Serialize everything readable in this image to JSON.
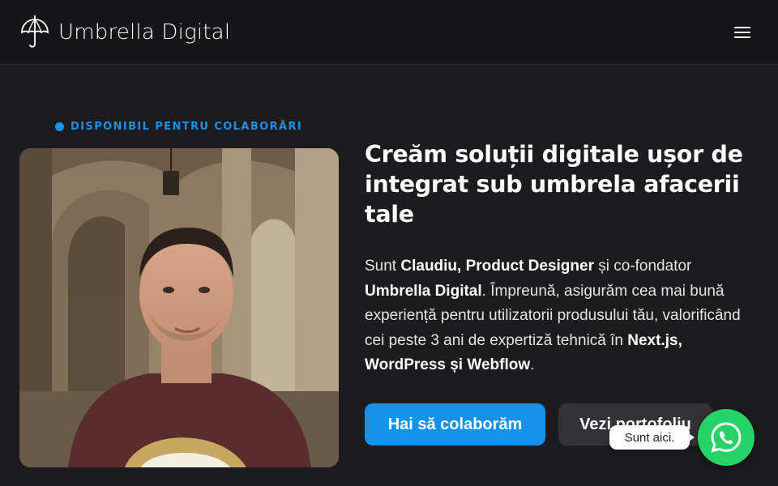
{
  "header": {
    "brand_name": "Umbrella Digital",
    "logo_icon": "umbrella-icon",
    "menu_icon": "hamburger-menu-icon"
  },
  "status": {
    "label": "DISPONIBIL PENTRU COLABORĂRI",
    "color": "#1592ea"
  },
  "hero": {
    "photo_icon": "portrait-photo",
    "headline": "Creăm soluții digitale ușor de integrat sub umbrela afacerii tale",
    "intro": {
      "t1": "Sunt ",
      "b1": "Claudiu, Product Designer",
      "t2": " și co-fondator ",
      "b2": "Umbrella Digital",
      "t3": ". Împreună, asigurăm cea mai bună experiență pentru utilizatorii produsului tău, valorificând cei peste 3 ani de expertiză tehnică în ",
      "b3": "Next.js, WordPress și Webflow",
      "t4": "."
    },
    "primary_button": "Hai să colaborăm",
    "secondary_button": "Vezi portofoliu"
  },
  "chat": {
    "tooltip": "Sunt aici.",
    "icon": "whatsapp-icon",
    "color": "#25d366"
  },
  "colors": {
    "background": "#1c1c1f",
    "header": "#161619",
    "accent": "#1592ea"
  }
}
